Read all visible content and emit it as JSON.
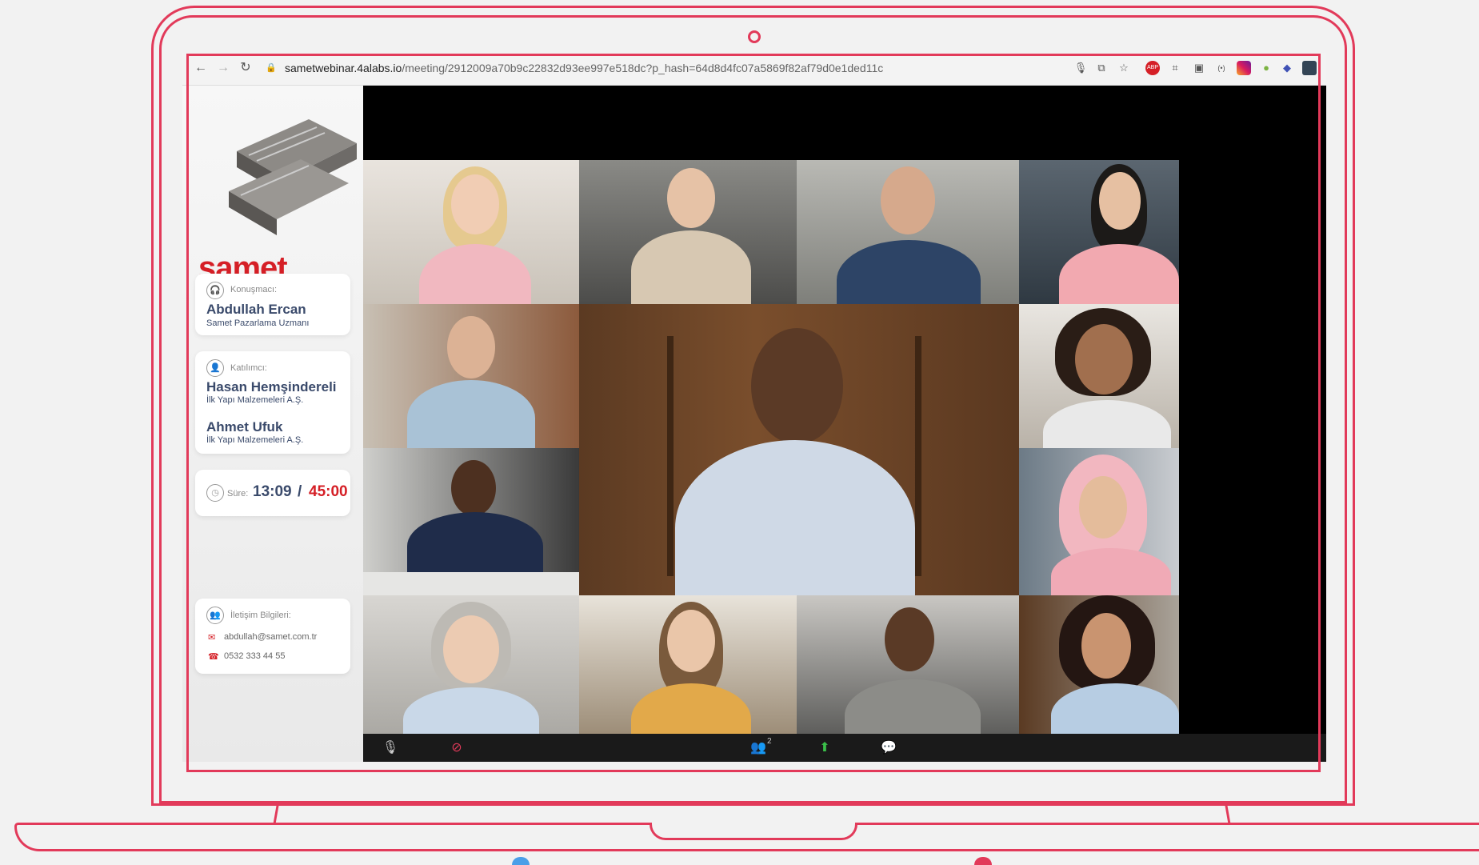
{
  "browser": {
    "url_host": "sametwebinar.4alabs.io",
    "url_path": "/meeting/2912009a70b9c22832d93ee997e518dc?p_hash=64d8d4fc07a5869f82af79d0e1ded11c"
  },
  "brand": {
    "logo_text": "samet",
    "accent_color": "#d51f26",
    "frame_color": "#e23a5a"
  },
  "speaker": {
    "label": "Konuşmacı:",
    "name": "Abdullah Ercan",
    "title": "Samet Pazarlama Uzmanı"
  },
  "participants": {
    "label": "Katılımcı:",
    "items": [
      {
        "name": "Hasan Hemşindereli",
        "company": "İlk Yapı Malzemeleri A.Ş."
      },
      {
        "name": "Ahmet Ufuk",
        "company": "İlk Yapı Malzemeleri A.Ş."
      }
    ]
  },
  "duration": {
    "label": "Süre:",
    "elapsed": "13:09",
    "separator": "/",
    "total": "45:00"
  },
  "contact": {
    "label": "İletişim Bilgileri:",
    "email": "abdullah@samet.com.tr",
    "phone": "0532 333 44 55"
  },
  "toolbar": {
    "participants_count": "2"
  },
  "icons": [
    "back-icon",
    "forward-icon",
    "reload-icon",
    "lock-icon",
    "mic-icon",
    "translate-icon",
    "star-icon",
    "adblock-icon",
    "screenshot-icon",
    "pip-icon",
    "cast-icon",
    "instagram-icon",
    "drop-icon",
    "extension-icon",
    "headset-icon",
    "user-icon",
    "clock-icon",
    "people-icon",
    "mail-icon",
    "phone-icon",
    "camera-off-icon",
    "share-screen-icon",
    "chat-icon"
  ]
}
